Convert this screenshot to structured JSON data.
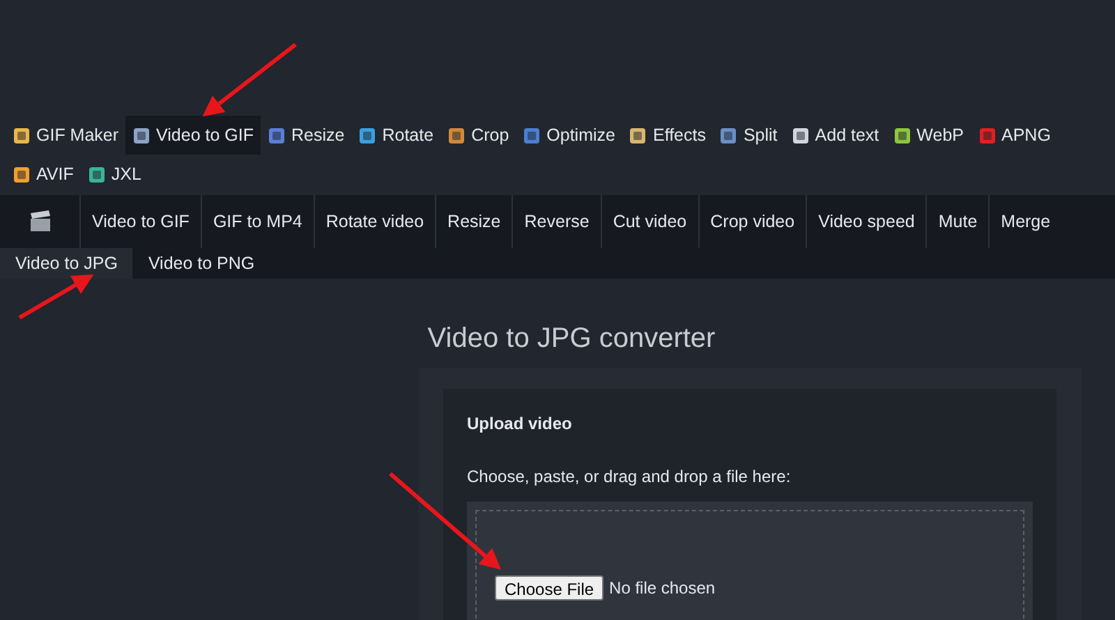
{
  "nav": [
    {
      "label": "GIF Maker",
      "selected": false
    },
    {
      "label": "Video to GIF",
      "selected": true
    },
    {
      "label": "Resize",
      "selected": false
    },
    {
      "label": "Rotate",
      "selected": false
    },
    {
      "label": "Crop",
      "selected": false
    },
    {
      "label": "Optimize",
      "selected": false
    },
    {
      "label": "Effects",
      "selected": false
    },
    {
      "label": "Split",
      "selected": false
    },
    {
      "label": "Add text",
      "selected": false
    },
    {
      "label": "WebP",
      "selected": false
    },
    {
      "label": "APNG",
      "selected": false
    },
    {
      "label": "AVIF",
      "selected": false
    },
    {
      "label": "JXL",
      "selected": false
    }
  ],
  "subnav": [
    {
      "label": "Video to GIF",
      "selected": false
    },
    {
      "label": "GIF to MP4",
      "selected": false
    },
    {
      "label": "Rotate video",
      "selected": false
    },
    {
      "label": "Resize",
      "selected": false
    },
    {
      "label": "Reverse",
      "selected": false
    },
    {
      "label": "Cut video",
      "selected": false
    },
    {
      "label": "Crop video",
      "selected": false
    },
    {
      "label": "Video speed",
      "selected": false
    },
    {
      "label": "Mute",
      "selected": false
    },
    {
      "label": "Merge",
      "selected": false
    },
    {
      "label": "Video to JPG",
      "selected": true
    },
    {
      "label": "Video to PNG",
      "selected": false
    }
  ],
  "title": "Video to JPG converter",
  "upload": {
    "legend": "Upload video",
    "instruction": "Choose, paste, or drag and drop a file here:",
    "button": "Choose File",
    "status": "No file chosen"
  }
}
